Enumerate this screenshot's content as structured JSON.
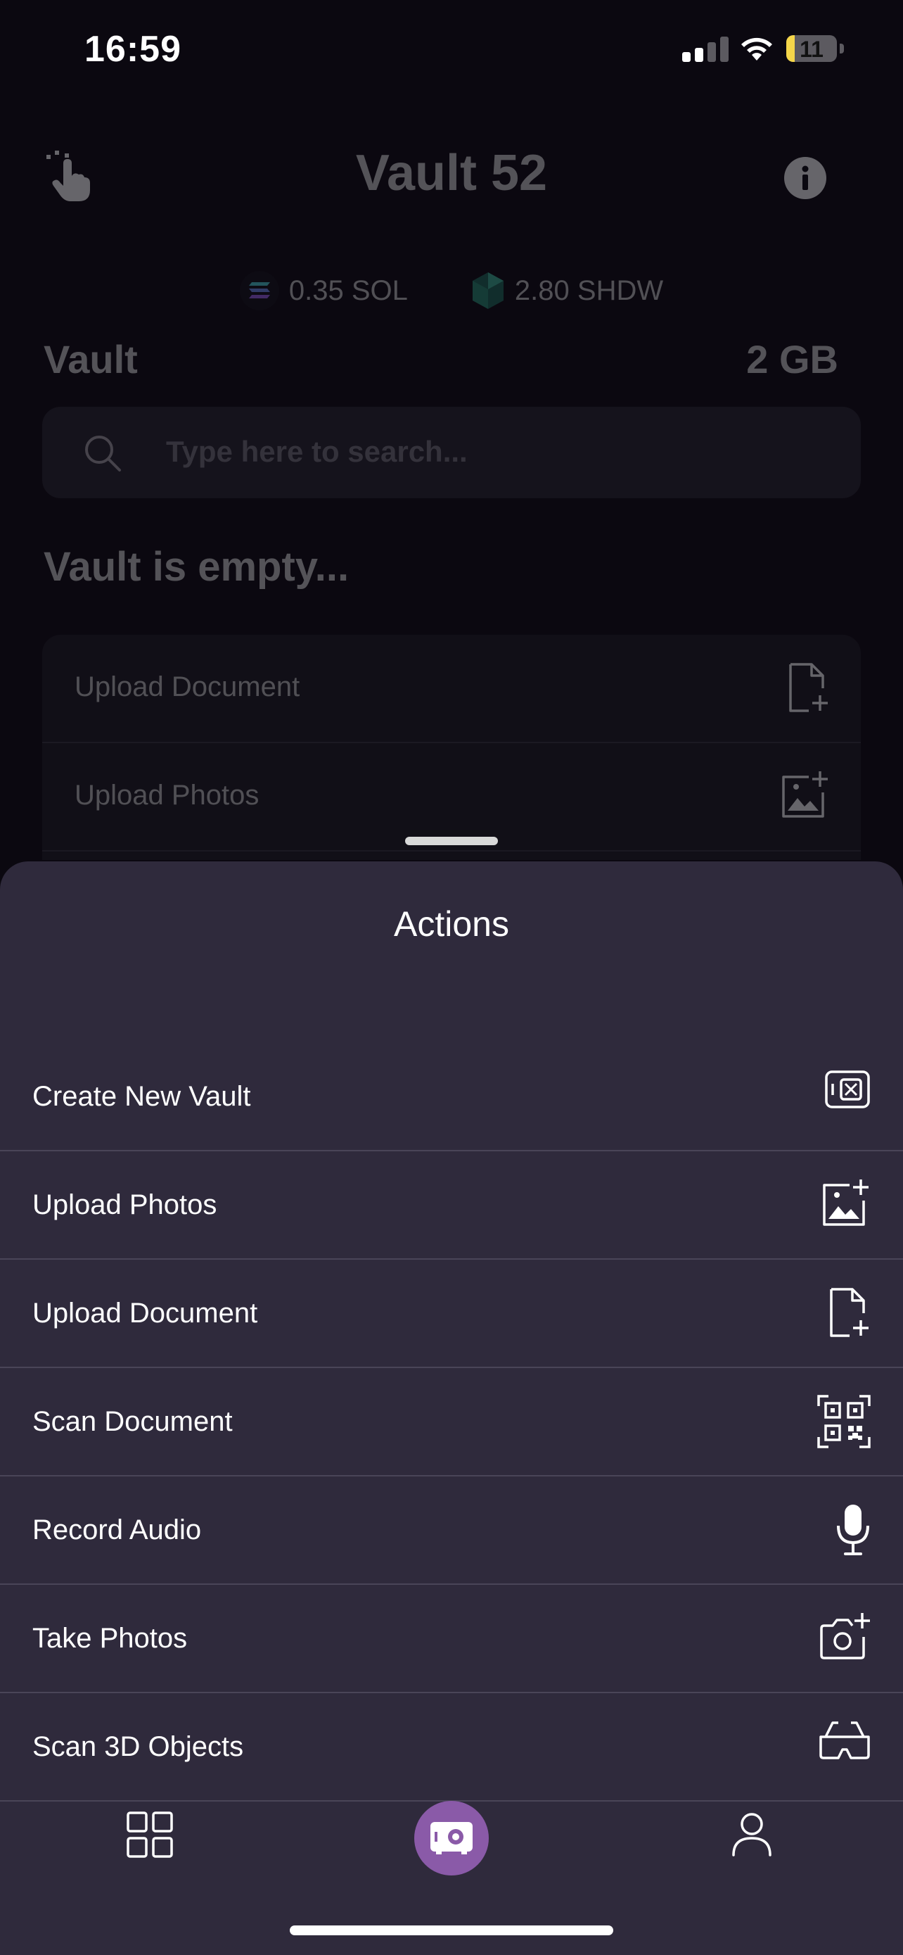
{
  "status_bar": {
    "time": "16:59",
    "battery": "11"
  },
  "header": {
    "title": "Vault 52"
  },
  "balances": [
    {
      "amount": "0.35 SOL",
      "icon": "solana-icon"
    },
    {
      "amount": "2.80 SHDW",
      "icon": "shadow-token-icon"
    }
  ],
  "vault_section": {
    "label": "Vault",
    "size": "2 GB"
  },
  "search": {
    "placeholder": "Type here to search..."
  },
  "empty_message": "Vault is empty...",
  "background_list": [
    {
      "label": "Upload Document",
      "icon": "file-plus-icon"
    },
    {
      "label": "Upload Photos",
      "icon": "image-plus-icon"
    }
  ],
  "sheet": {
    "title": "Actions",
    "actions": [
      {
        "label": "Create New Vault",
        "icon": "vault-icon"
      },
      {
        "label": "Upload Photos",
        "icon": "image-plus-icon"
      },
      {
        "label": "Upload Document",
        "icon": "file-plus-icon"
      },
      {
        "label": "Scan Document",
        "icon": "qr-code-icon"
      },
      {
        "label": "Record Audio",
        "icon": "microphone-icon"
      },
      {
        "label": "Take Photos",
        "icon": "camera-plus-icon"
      },
      {
        "label": "Scan 3D Objects",
        "icon": "3d-glasses-icon"
      }
    ]
  },
  "tab_bar": {
    "items": [
      {
        "icon": "grid-icon"
      },
      {
        "icon": "vault-icon",
        "active": true
      },
      {
        "icon": "profile-icon"
      }
    ]
  },
  "colors": {
    "background": "#0b0810",
    "sheet": "#2f2a3c",
    "accent": "#8a5aa8",
    "battery": "#f5d64a"
  }
}
